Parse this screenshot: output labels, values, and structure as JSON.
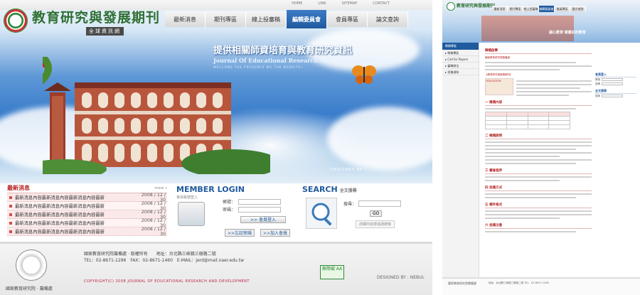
{
  "home": {
    "top_links": [
      "HOME",
      "LINK",
      "SITEMAP",
      "CONTACT"
    ],
    "logo": {
      "title": "教育研究與發展期刊",
      "subtitle": "全球資訊網"
    },
    "nav": [
      {
        "label": "最新消息",
        "active": false
      },
      {
        "label": "期刊專區",
        "active": false
      },
      {
        "label": "線上投審稿",
        "active": false
      },
      {
        "label": "編輯委員會",
        "active": true
      },
      {
        "label": "會員專區",
        "active": false
      },
      {
        "label": "論文查詢",
        "active": false
      }
    ],
    "hero": {
      "tagline": "提供相關師資培育與教育研究資訊",
      "english": "Journal Of Educational Research And Development...",
      "welcome": "WELCOME THE PRESENCE WE THE WEBSITE~",
      "designed_by": "DESIGNED BY :"
    },
    "news": {
      "title": "最新消息",
      "more": "more »",
      "items": [
        {
          "text": "最新消息內容最新消息內容最新消息內容最新",
          "date": "2008 / 12 / 30"
        },
        {
          "text": "最新消息內容最新消息內容最新消息內容最新",
          "date": "2008 / 12 / 30"
        },
        {
          "text": "最新消息內容最新消息內容最新消息內容最新",
          "date": "2008 / 12 / 30"
        },
        {
          "text": "最新消息內容最新消息內容最新消息內容最新",
          "date": "2008 / 12 / 30"
        },
        {
          "text": "最新消息內容最新消息內容最新消息內容最新",
          "date": "2008 / 12 / 30"
        }
      ]
    },
    "member": {
      "title": "MEMBER LOGIN",
      "subtitle": "會員帳號登入",
      "account_label": "帳號：",
      "password_label": "密碼：",
      "login_button": ">> 會員登入",
      "forgot_button": ">>忘記密碼",
      "join_button": ">>加入會員"
    },
    "search": {
      "title": "SEARCH",
      "title_sub": "全文搜尋",
      "keyword_label": "搜尋：",
      "go_button": "GO",
      "hint": "詳細內容搜尋請按我"
    },
    "footer": {
      "org": "國家教育研究院 · 籌備處",
      "info_line1": "國家教育研究院籌備處 · 版權所有　　地址：台北縣三峽鎮三樹路二號",
      "info_line2": "TEL：02-8671-1296　FAX：02-8671-1460　E-MAIL：jerd@mail.naer.edu.tw",
      "copyright": "COPYRIGHT(C) 2008 JOURNAL OF EDUCATIONAL RESEARCH AND DEVELOPMENT",
      "badge": "無障礙 AA",
      "designed": "DESIGNED BY : NEBUL"
    }
  },
  "inner": {
    "title": "教育研究與發展期刊",
    "nav": [
      {
        "label": "最新消息",
        "active": false
      },
      {
        "label": "期刊專區",
        "active": false
      },
      {
        "label": "線上投審稿",
        "active": false
      },
      {
        "label": "編輯委員會",
        "active": true
      },
      {
        "label": "會員專區",
        "active": false
      },
      {
        "label": "論文查詢",
        "active": false
      }
    ],
    "banner_text": "誠心教育 做最好的教育",
    "sidebar": {
      "head": "徵稿專區",
      "items": [
        "▸ 徵稿專區",
        "▸ Call for Papers",
        "▸ 審稿辦法",
        "▸ 投稿須知"
      ]
    },
    "main": {
      "heading": "徵稿啟事",
      "intro": "國家教育研究院籌備處",
      "section_intro": "【教育研究與發展期刊】",
      "tag": "EDUCATION",
      "sections": [
        "一 徵稿內容",
        "二 徵稿說明",
        "三 審查程序",
        "四 投稿方式",
        "五 稿件格式",
        "六 投稿注意"
      ]
    },
    "right_panel": {
      "title1": "會員登入",
      "title2": "全文搜尋",
      "labels": [
        "帳號",
        "密碼",
        "搜尋"
      ]
    },
    "footer": {
      "org": "國家教育研究院籌備處",
      "info": "地址：台北縣三峽鎮三樹路二號 TEL：02-8671-1296"
    }
  }
}
